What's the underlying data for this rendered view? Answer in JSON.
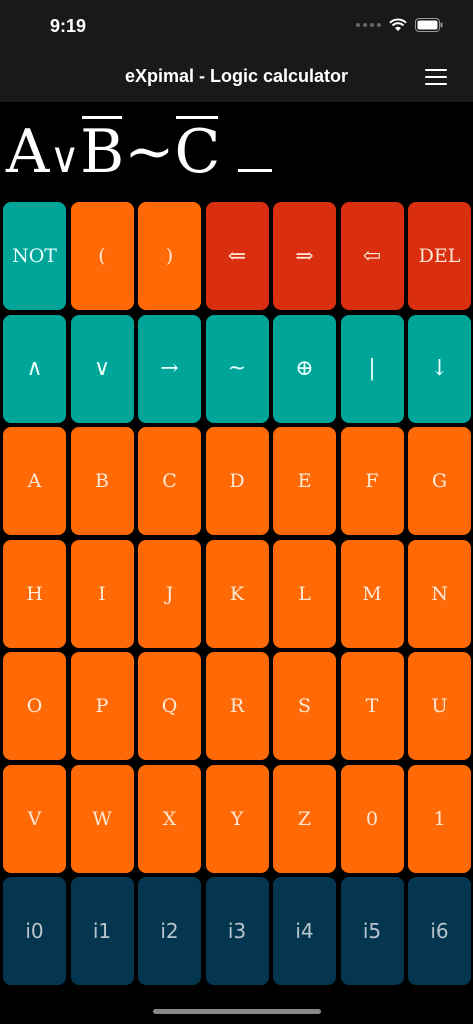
{
  "status": {
    "time": "9:19"
  },
  "header": {
    "title": "eXpimal - Logic calculator"
  },
  "expression": {
    "tokens": [
      {
        "text": "A",
        "negated": false
      },
      {
        "text": "∨",
        "negated": false,
        "op": true
      },
      {
        "text": "B",
        "negated": true
      },
      {
        "text": "~",
        "negated": false
      },
      {
        "text": "C",
        "negated": true
      }
    ],
    "cursor": "_"
  },
  "keypad": {
    "rows": [
      [
        {
          "label": "NOT",
          "color": "teal"
        },
        {
          "label": "(",
          "color": "orange"
        },
        {
          "label": ")",
          "color": "orange"
        },
        {
          "label": "⇐",
          "color": "red"
        },
        {
          "label": "⇒",
          "color": "red"
        },
        {
          "label": "⇦",
          "color": "red"
        },
        {
          "label": "DEL",
          "color": "red"
        }
      ],
      [
        {
          "label": "∧",
          "color": "teal"
        },
        {
          "label": "∨",
          "color": "teal"
        },
        {
          "label": "→",
          "color": "teal"
        },
        {
          "label": "~",
          "color": "teal"
        },
        {
          "label": "⊕",
          "color": "teal"
        },
        {
          "label": "|",
          "color": "teal"
        },
        {
          "label": "↓",
          "color": "teal"
        }
      ],
      [
        {
          "label": "A",
          "color": "orange"
        },
        {
          "label": "B",
          "color": "orange"
        },
        {
          "label": "C",
          "color": "orange"
        },
        {
          "label": "D",
          "color": "orange"
        },
        {
          "label": "E",
          "color": "orange"
        },
        {
          "label": "F",
          "color": "orange"
        },
        {
          "label": "G",
          "color": "orange"
        }
      ],
      [
        {
          "label": "H",
          "color": "orange"
        },
        {
          "label": "I",
          "color": "orange"
        },
        {
          "label": "J",
          "color": "orange"
        },
        {
          "label": "K",
          "color": "orange"
        },
        {
          "label": "L",
          "color": "orange"
        },
        {
          "label": "M",
          "color": "orange"
        },
        {
          "label": "N",
          "color": "orange"
        }
      ],
      [
        {
          "label": "O",
          "color": "orange"
        },
        {
          "label": "P",
          "color": "orange"
        },
        {
          "label": "Q",
          "color": "orange"
        },
        {
          "label": "R",
          "color": "orange"
        },
        {
          "label": "S",
          "color": "orange"
        },
        {
          "label": "T",
          "color": "orange"
        },
        {
          "label": "U",
          "color": "orange"
        }
      ],
      [
        {
          "label": "V",
          "color": "orange"
        },
        {
          "label": "W",
          "color": "orange"
        },
        {
          "label": "X",
          "color": "orange"
        },
        {
          "label": "Y",
          "color": "orange"
        },
        {
          "label": "Z",
          "color": "orange"
        },
        {
          "label": "0",
          "color": "orange"
        },
        {
          "label": "1",
          "color": "orange"
        }
      ],
      [
        {
          "label": "i0",
          "color": "navy"
        },
        {
          "label": "i1",
          "color": "navy"
        },
        {
          "label": "i2",
          "color": "navy"
        },
        {
          "label": "i3",
          "color": "navy"
        },
        {
          "label": "i4",
          "color": "navy"
        },
        {
          "label": "i5",
          "color": "navy"
        },
        {
          "label": "i6",
          "color": "navy"
        }
      ]
    ]
  },
  "colors": {
    "orange": "#ff6a07",
    "red": "#d92e10",
    "teal": "#00a59a",
    "navy": "#053650",
    "bar": "#191919"
  }
}
